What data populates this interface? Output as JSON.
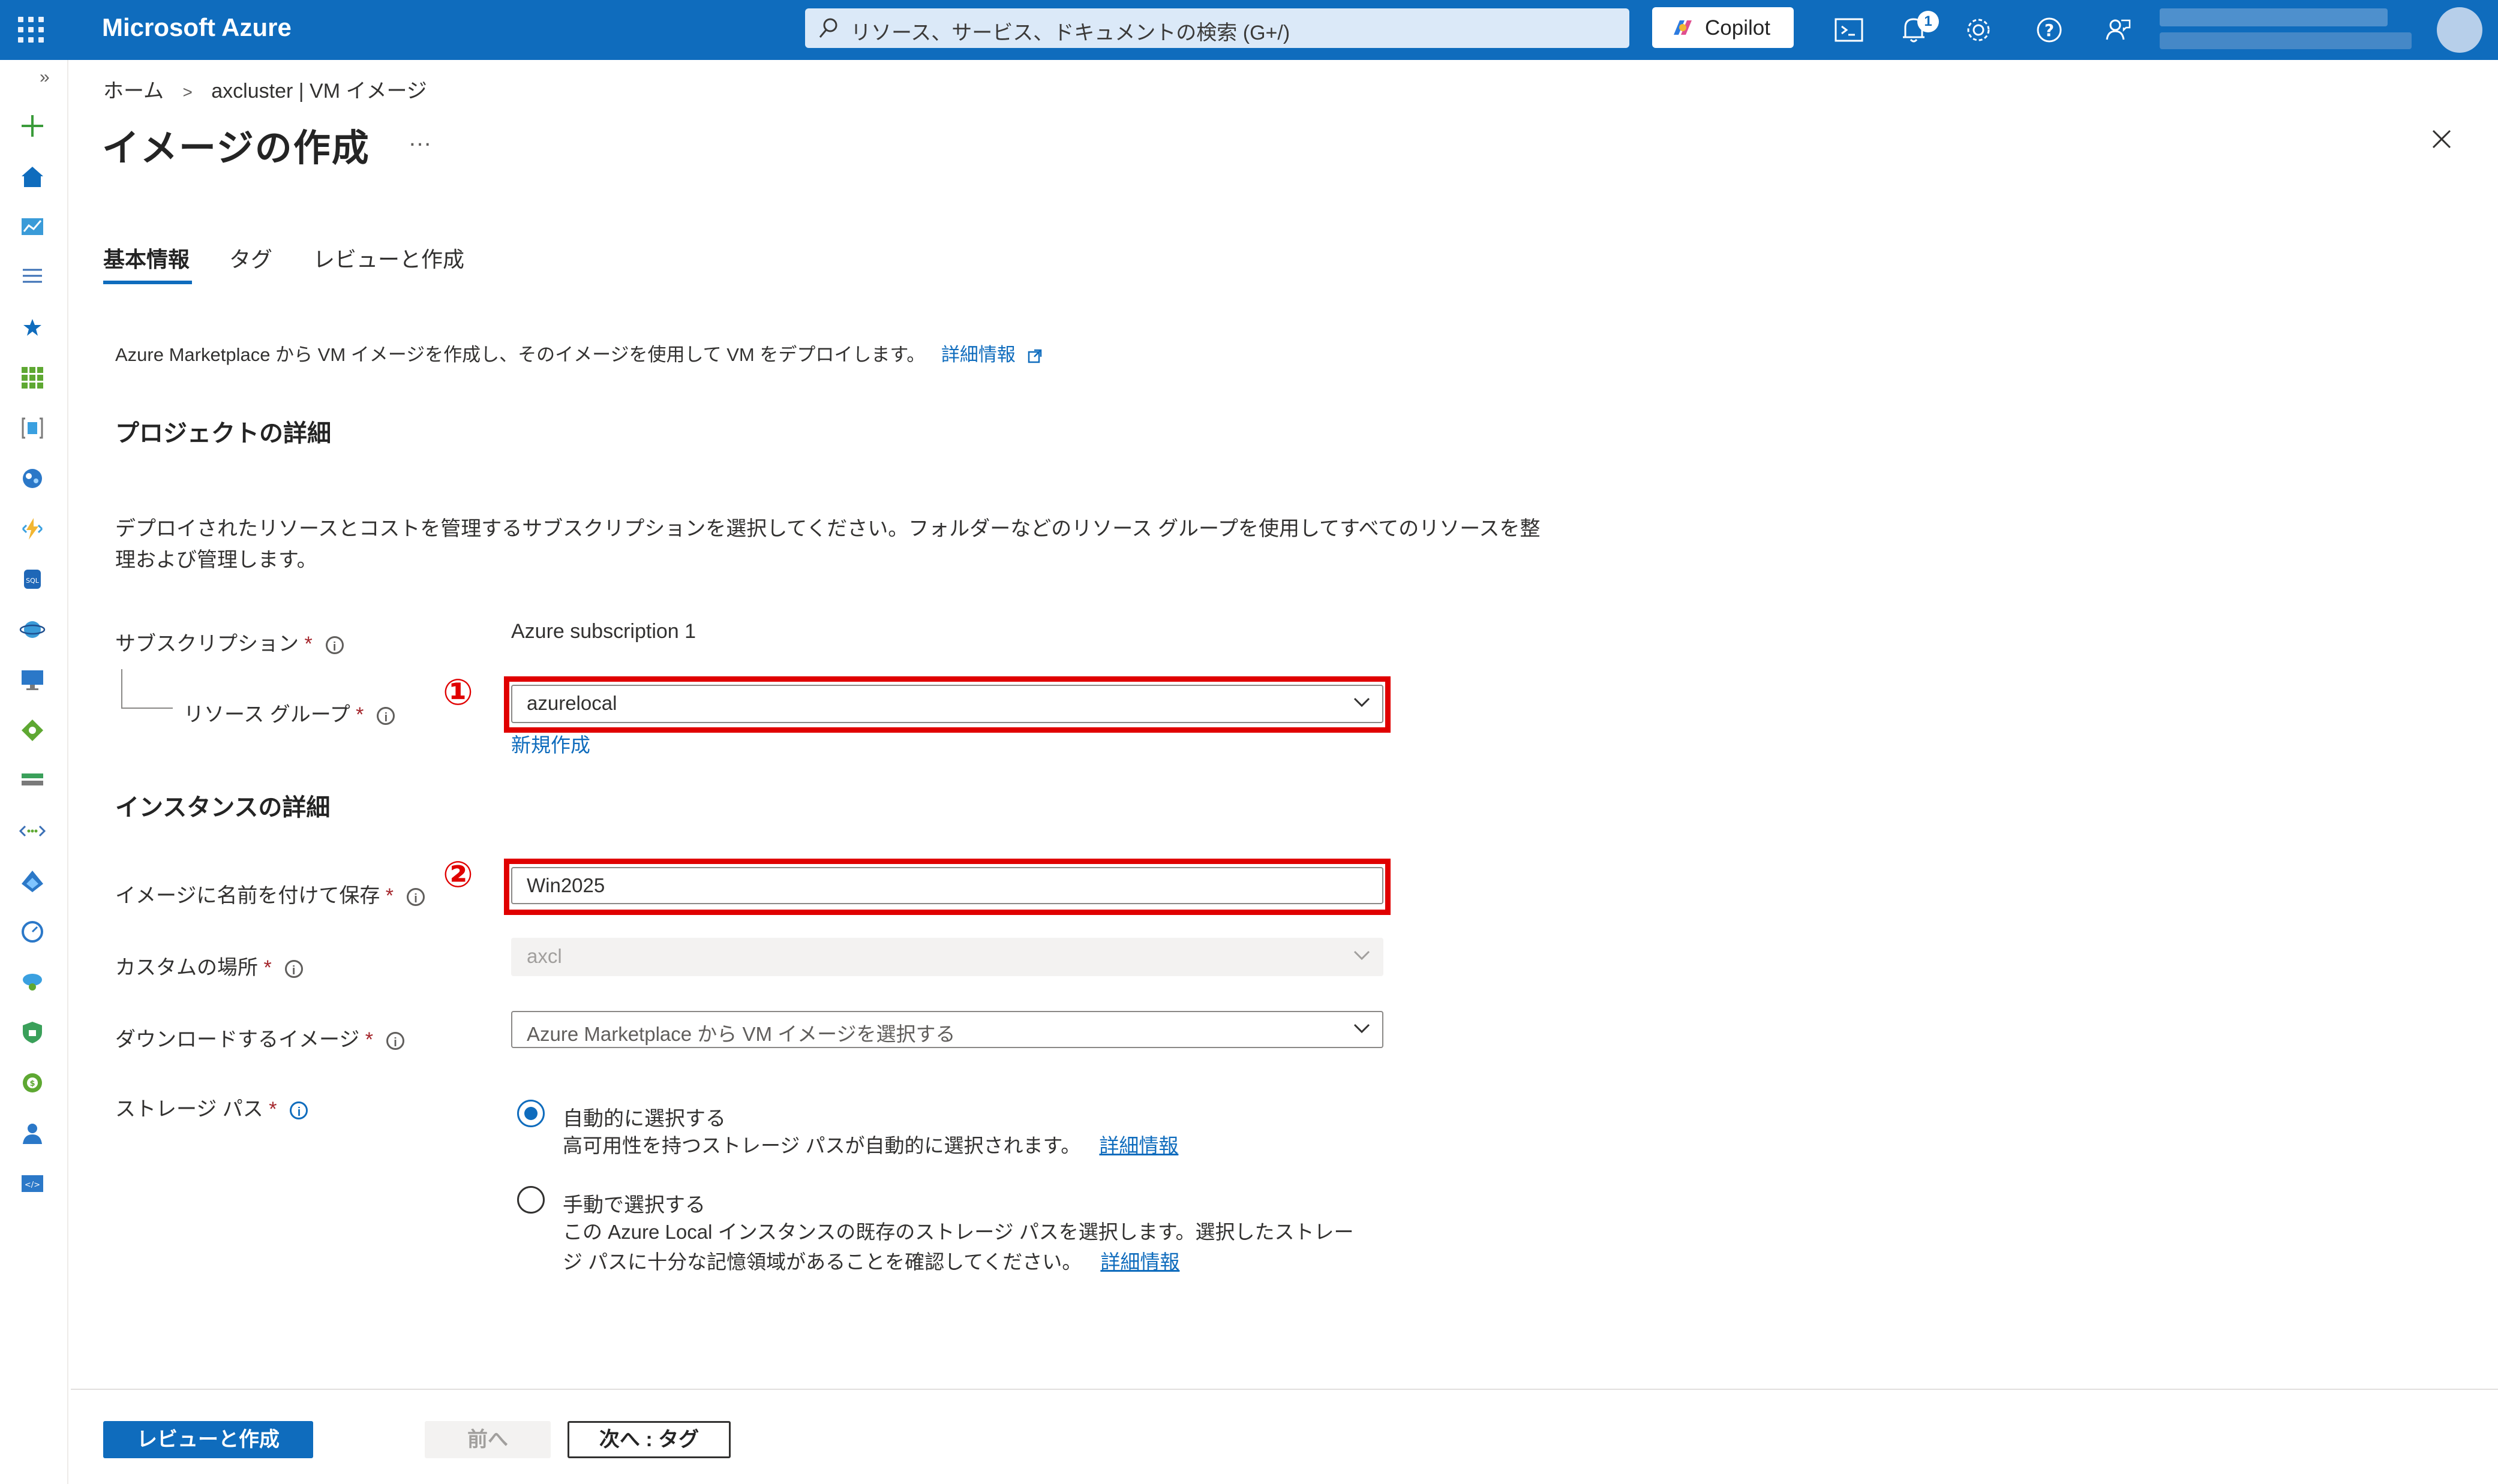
{
  "topbar": {
    "brand": "Microsoft Azure",
    "search_placeholder": "リソース、サービス、ドキュメントの検索 (G+/)",
    "copilot_label": "Copilot",
    "notification_count": "1",
    "icons": [
      "waffle-menu-icon",
      "cloud-shell-icon",
      "notifications-icon",
      "settings-icon",
      "help-icon",
      "feedback-icon"
    ]
  },
  "breadcrumb": {
    "home": "ホーム",
    "separator": ">",
    "parent": "axcluster | VM イメージ"
  },
  "page": {
    "title": "イメージの作成",
    "more": "…"
  },
  "tabs": [
    {
      "label": "基本情報",
      "active": true
    },
    {
      "label": "タグ",
      "active": false
    },
    {
      "label": "レビューと作成",
      "active": false
    }
  ],
  "intro": {
    "text": "Azure Marketplace から VM イメージを作成し、そのイメージを使用して VM をデプロイします。",
    "link": "詳細情報"
  },
  "project": {
    "heading": "プロジェクトの詳細",
    "description": "デプロイされたリソースとコストを管理するサブスクリプションを選択してください。フォルダーなどのリソース グループを使用してすべてのリソースを整理および管理します。",
    "subscription_label": "サブスクリプション",
    "subscription_value": "Azure subscription 1",
    "resource_group_label": "リソース グループ",
    "resource_group_value": "azurelocal",
    "create_new": "新規作成"
  },
  "instance": {
    "heading": "インスタンスの詳細",
    "image_name_label": "イメージに名前を付けて保存",
    "image_name_value": "Win2025",
    "custom_location_label": "カスタムの場所",
    "custom_location_value": "axcl",
    "download_image_label": "ダウンロードするイメージ",
    "download_image_value": "Azure Marketplace から VM イメージを選択する",
    "storage_path_label": "ストレージ パス",
    "required_mark": "*"
  },
  "storage_options": [
    {
      "title": "自動的に選択する",
      "desc": "高可用性を持つストレージ パスが自動的に選択されます。",
      "link": "詳細情報",
      "selected": true
    },
    {
      "title": "手動で選択する",
      "desc": "この Azure Local インスタンスの既存のストレージ パスを選択します。選択したストレージ パスに十分な記憶領域があることを確認してください。",
      "link": "詳細情報",
      "selected": false
    }
  ],
  "annotations": {
    "marker1": "①",
    "marker2": "②",
    "color": "#e00000"
  },
  "footer": {
    "review_create": "レビューと作成",
    "previous": "前へ",
    "next": "次へ : タグ"
  },
  "colors": {
    "azure_blue": "#0f6cbd",
    "required_red": "#a4262c"
  }
}
